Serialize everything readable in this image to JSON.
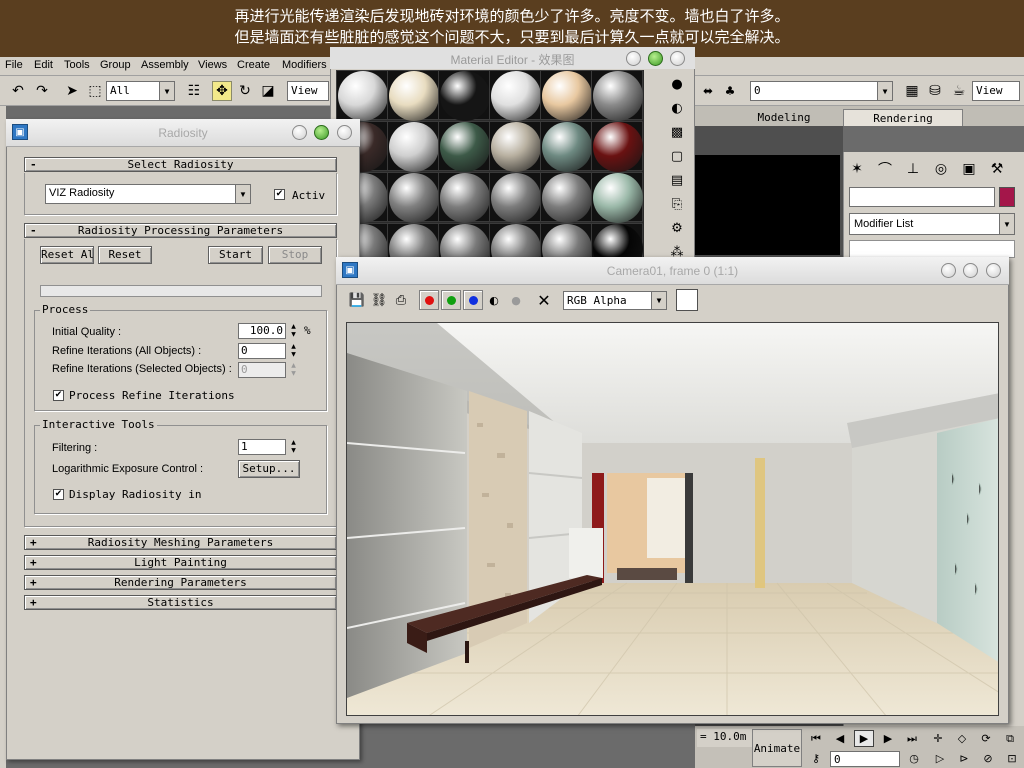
{
  "banner": {
    "line1": "再进行光能传递渲染后发现地砖对环境的颜色少了许多。亮度不变。墙也白了许多。",
    "line2": "但是墙面还有些脏脏的感觉这个问题不大，只要到最后计算久一点就可以完全解决。"
  },
  "menu": [
    "File",
    "Edit",
    "Tools",
    "Group",
    "Assembly",
    "Views",
    "Create",
    "Modifiers"
  ],
  "toolbar": {
    "selection_filter": "All",
    "view_label_left": "View",
    "view_label_right": "View",
    "render_combo_value": "0"
  },
  "command_panel": {
    "tabs": [
      "Modeling",
      "Rendering"
    ],
    "modifier_list": "Modifier List"
  },
  "bottom": {
    "scale": "= 10.0m",
    "animate_label": "Animate",
    "frame_value": "0"
  },
  "material_editor": {
    "title": "Material Editor - 效果图",
    "spheres": [
      "#d8d8d8",
      "#e8dcc0",
      "#151515",
      "#e0e0e0",
      "#e8c8a0",
      "#8a8a8a",
      "#3a2a28",
      "#cfcfcf",
      "#3d5a48",
      "#b8b0a0",
      "#6e8a82",
      "#6a1212",
      "#7c7c7c",
      "#808080",
      "#7c7c7c",
      "#7c7c7c",
      "#7c7c7c",
      "#9ab8a8",
      "#7a7a7a",
      "#7a7a7a",
      "#7a7a7a",
      "#7a7a7a",
      "#7a7a7a",
      "#050505"
    ]
  },
  "radiosity": {
    "title": "Radiosity",
    "select_rollout": "Select Radiosity",
    "engine": "VIZ Radiosity",
    "active_label": "Activ",
    "processing_rollout": "Radiosity Processing Parameters",
    "reset_all": "Reset All",
    "reset": "Reset",
    "start": "Start",
    "stop": "Stop",
    "process_group": "Process",
    "initial_quality_label": "Initial Quality :",
    "initial_quality_value": "100.0",
    "percent": "%",
    "refine_all_label": "Refine Iterations (All Objects) :",
    "refine_all_value": "0",
    "refine_selected_label": "Refine Iterations (Selected Objects) :",
    "refine_selected_value": "0",
    "process_refine": "Process Refine Iterations",
    "interactive_group": "Interactive Tools",
    "filtering_label": "Filtering :",
    "filtering_value": "1",
    "exposure_label": "Logarithmic Exposure Control :",
    "setup": "Setup...",
    "display_radiosity": "Display Radiosity in",
    "collapsed_rollouts": [
      "Radiosity Meshing Parameters",
      "Light Painting",
      "Rendering Parameters",
      "Statistics"
    ]
  },
  "camera_window": {
    "title": "Camera01, frame 0 (1:1)",
    "channel": "RGB Alpha"
  }
}
